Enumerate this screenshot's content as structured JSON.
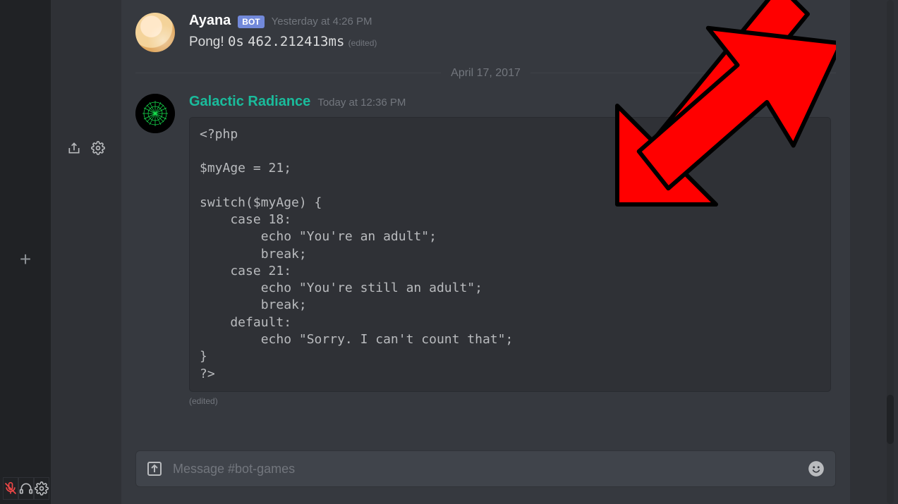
{
  "messages": [
    {
      "author": "Ayana",
      "is_bot": true,
      "bot_tag": "BOT",
      "timestamp": "Yesterday at 4:26 PM",
      "content_prefix": "Pong!",
      "content_mono1": "0s",
      "content_mono2": "462.212413ms",
      "edited": "(edited)"
    },
    {
      "author": "Galactic Radiance",
      "timestamp": "Today at 12:36 PM",
      "code": "<?php\n\n$myAge = 21;\n\nswitch($myAge) {\n    case 18:\n        echo \"You're an adult\";\n        break;\n    case 21:\n        echo \"You're still an adult\";\n        break;\n    default:\n        echo \"Sorry. I can't count that\";\n}\n?>",
      "edited": "(edited)"
    }
  ],
  "date_divider": "April 17, 2017",
  "input": {
    "placeholder": "Message #bot-games"
  },
  "server_add_label": "+"
}
